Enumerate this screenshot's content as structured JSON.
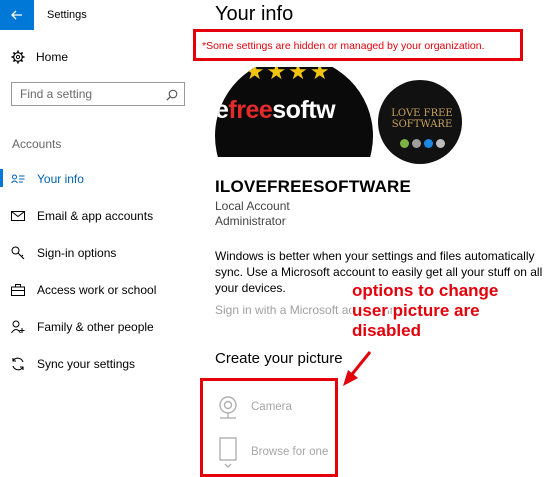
{
  "window": {
    "title": "Settings",
    "back_icon": "back-arrow-icon",
    "accent": "#0078d7"
  },
  "sidebar": {
    "home_label": "Home",
    "search_placeholder": "Find a setting",
    "section_label": "Accounts",
    "items": [
      {
        "label": "Your info",
        "icon": "user-card-icon",
        "active": true
      },
      {
        "label": "Email & app accounts",
        "icon": "mail-icon",
        "active": false
      },
      {
        "label": "Sign-in options",
        "icon": "key-icon",
        "active": false
      },
      {
        "label": "Access work or school",
        "icon": "briefcase-icon",
        "active": false
      },
      {
        "label": "Family & other people",
        "icon": "add-person-icon",
        "active": false
      },
      {
        "label": "Sync your settings",
        "icon": "sync-icon",
        "active": false
      }
    ]
  },
  "main": {
    "title": "Your info",
    "policy_notice": "*Some settings are hidden or managed by your organization.",
    "profile_picture_text": {
      "prefix": "e",
      "red": "free",
      "suffix": "softw"
    },
    "small_picture_text": "LOVE FREE SOFTWARE",
    "user_name": "ILOVEFREESOFTWARE",
    "account_type": "Local Account",
    "account_role": "Administrator",
    "info_paragraph": "Windows is better when your settings and files automatically sync. Use a Microsoft account to easily get all your stuff on all your devices.",
    "signin_link": "Sign in with a Microsoft account instead",
    "create_picture_title": "Create your picture",
    "options": [
      {
        "label": "Camera",
        "icon": "camera-icon"
      },
      {
        "label": "Browse for one",
        "icon": "browse-file-icon"
      }
    ]
  },
  "annotation": {
    "lines": [
      "options to change",
      "user picture are",
      "disabled"
    ],
    "color": "#e3000b"
  }
}
